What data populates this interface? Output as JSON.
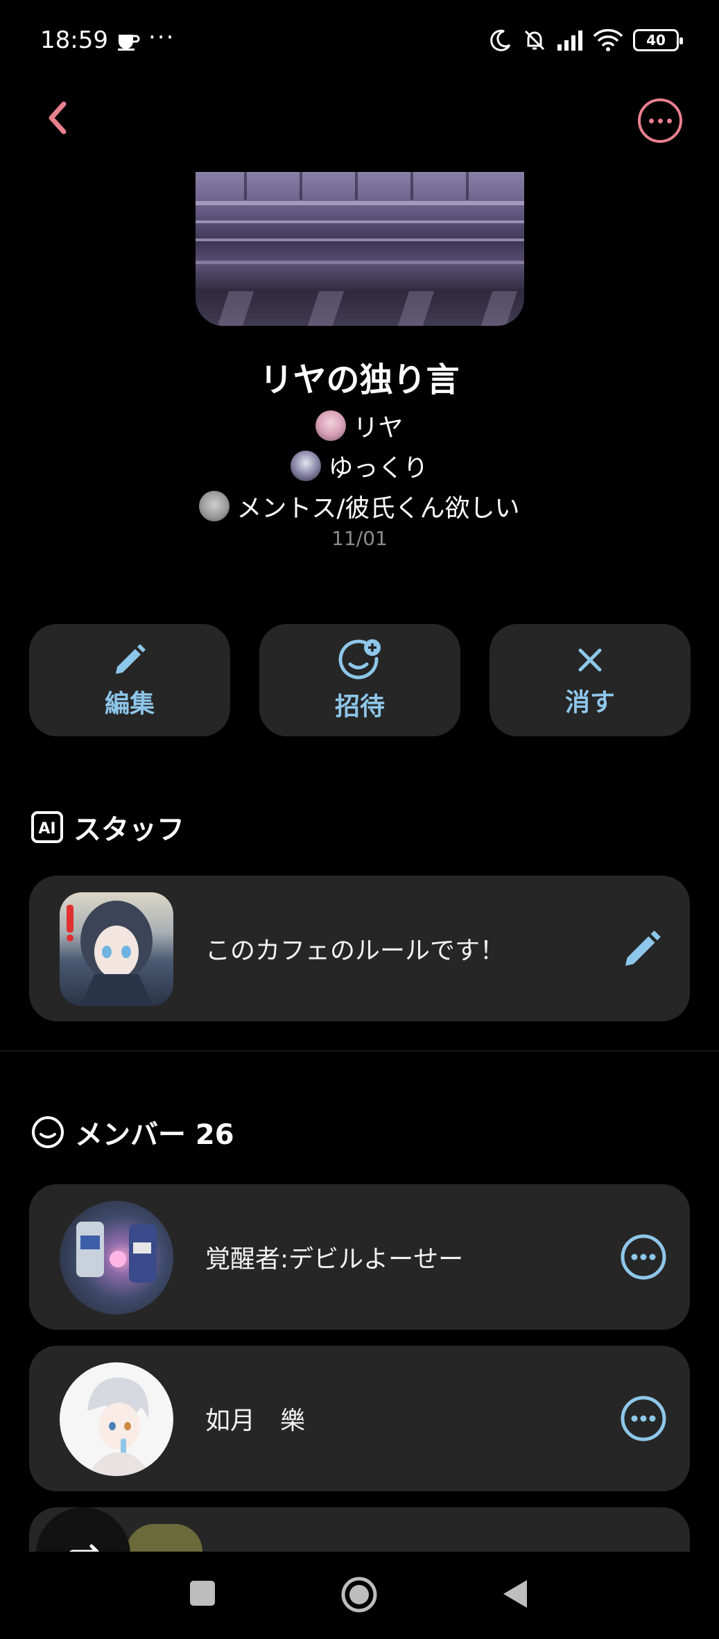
{
  "status": {
    "time": "18:59",
    "dots": "···",
    "battery": "40",
    "icons": [
      "tea-cup-icon",
      "moon-icon",
      "bell-off-icon",
      "signal-icon",
      "wifi-icon",
      "battery-icon"
    ]
  },
  "header": {
    "back_icon": "chevron-left-icon",
    "more_icon": "more-circle-icon",
    "accent": "#e8808e"
  },
  "cafe": {
    "title": "リヤの独り言",
    "owners": [
      {
        "name": "リヤ"
      },
      {
        "name": "ゆっくり"
      },
      {
        "name": "メントス/彼氏くん欲しい"
      }
    ],
    "date": "11/01"
  },
  "actions": [
    {
      "label": "編集",
      "icon": "pencil-icon"
    },
    {
      "label": "招待",
      "icon": "invite-smile-plus-icon"
    },
    {
      "label": "消す",
      "icon": "close-icon"
    }
  ],
  "staff": {
    "title": "スタッフ",
    "icon": "ai-icon",
    "rule_text": "このカフェのルールです！",
    "edit_icon": "pencil-icon"
  },
  "members": {
    "title": "メンバー 26",
    "icon": "smile-icon",
    "items": [
      {
        "name": "覚醒者:デビルよーせー"
      },
      {
        "name": "如月　樂"
      }
    ]
  },
  "colors": {
    "background": "#000000",
    "card": "#262626",
    "accent_blue": "#8ec7ea",
    "accent_pink": "#e8808e"
  },
  "navbar": {
    "icons": [
      "square-recents-icon",
      "circle-home-icon",
      "triangle-back-icon",
      "repost-icon"
    ]
  }
}
